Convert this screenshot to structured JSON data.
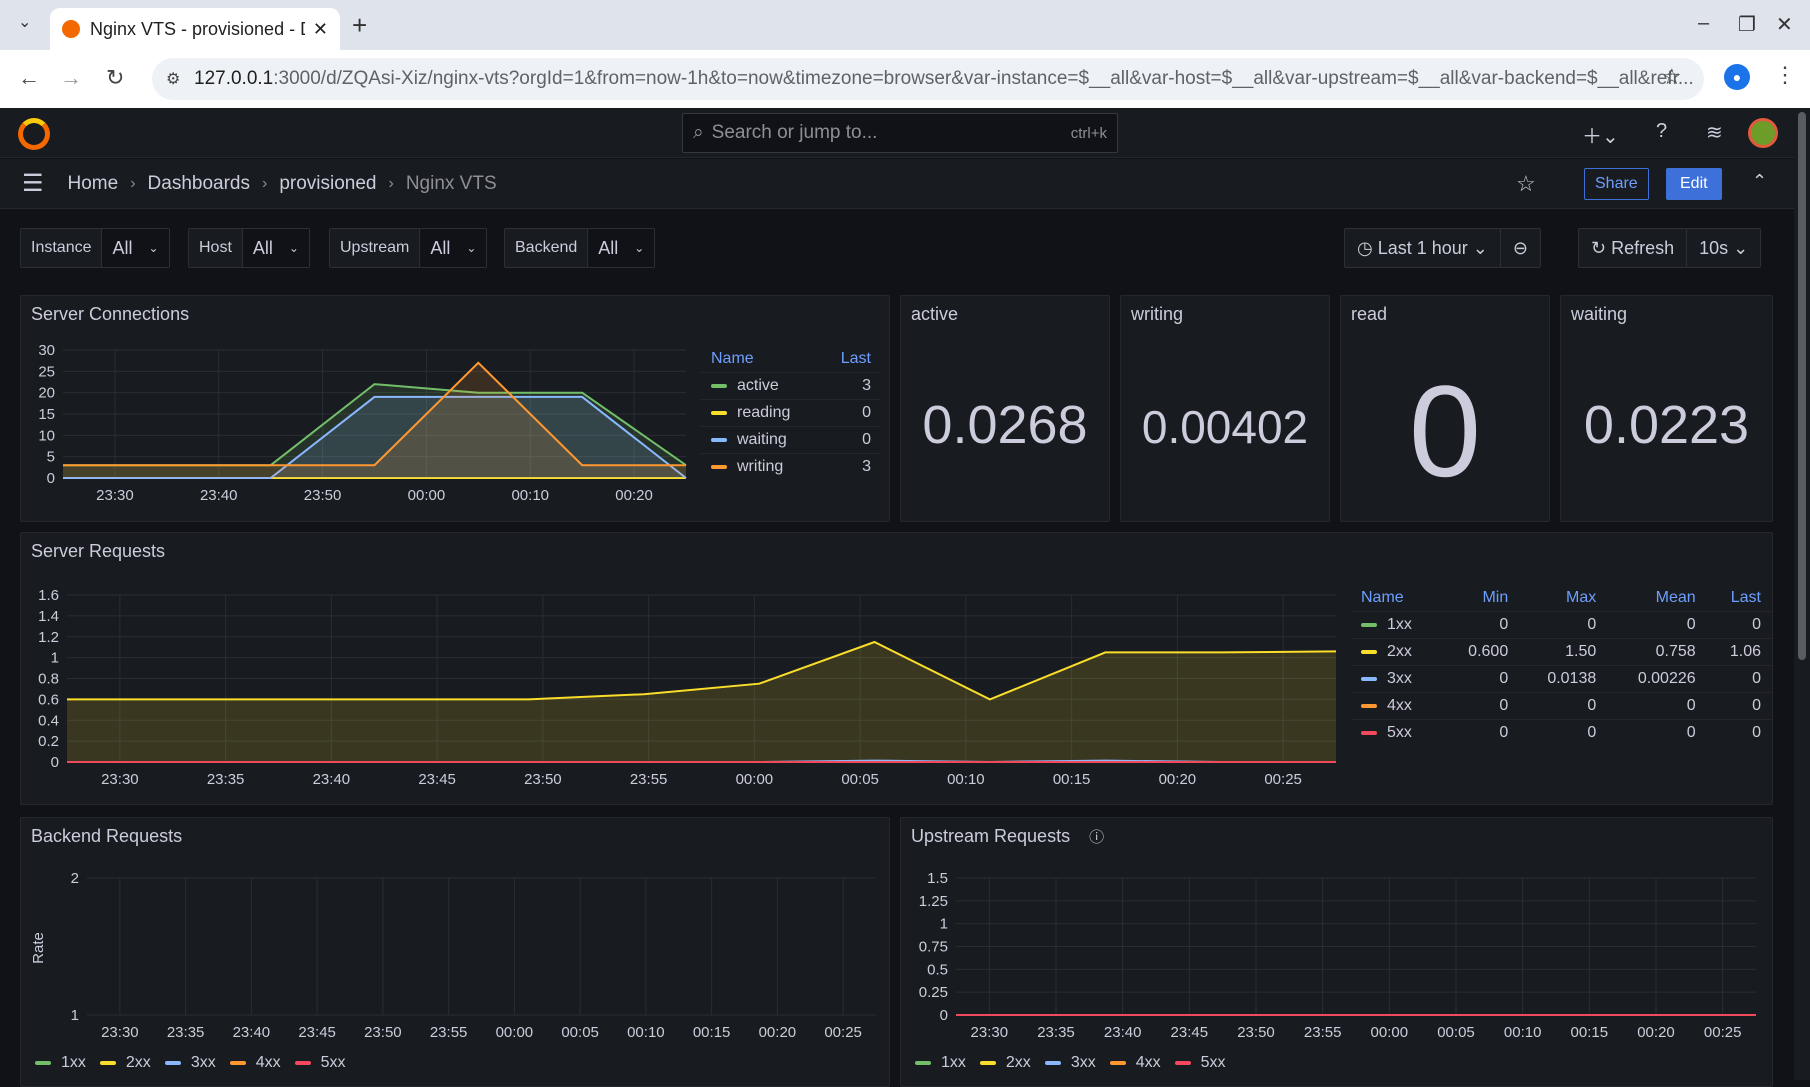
{
  "browser": {
    "tab_title": "Nginx VTS - provisioned - D",
    "url_host": "127.0.0.1",
    "url_rest": ":3000/d/ZQAsi-Xiz/nginx-vts?orgId=1&from=now-1h&to=now&timezone=browser&var-instance=$__all&var-host=$__all&var-upstream=$__all&var-backend=$__all&refr..."
  },
  "topbar": {
    "search_placeholder": "Search or jump to...",
    "search_kbd": "ctrl+k"
  },
  "breadcrumb": [
    "Home",
    "Dashboards",
    "provisioned",
    "Nginx VTS"
  ],
  "actions": {
    "share": "Share",
    "edit": "Edit"
  },
  "variables": [
    {
      "label": "Instance",
      "value": "All"
    },
    {
      "label": "Host",
      "value": "All"
    },
    {
      "label": "Upstream",
      "value": "All"
    },
    {
      "label": "Backend",
      "value": "All"
    }
  ],
  "time": {
    "range": "Last 1 hour",
    "refresh": "Refresh",
    "interval": "10s"
  },
  "stats": [
    {
      "title": "active",
      "value": "0.0268"
    },
    {
      "title": "writing",
      "value": "0.00402"
    },
    {
      "title": "read",
      "value": "0"
    },
    {
      "title": "waiting",
      "value": "0.0223"
    }
  ],
  "colors": {
    "green": "#73bf69",
    "yellow": "#fade2a",
    "blue": "#8ab8ff",
    "orange": "#ff9830",
    "red": "#f2495c"
  },
  "panels": {
    "conn": {
      "title": "Server Connections",
      "legend_headers": [
        "Name",
        "Last"
      ],
      "legend": [
        {
          "name": "active",
          "last": "3",
          "color": "#73bf69"
        },
        {
          "name": "reading",
          "last": "0",
          "color": "#fade2a"
        },
        {
          "name": "waiting",
          "last": "0",
          "color": "#8ab8ff"
        },
        {
          "name": "writing",
          "last": "3",
          "color": "#ff9830"
        }
      ]
    },
    "req": {
      "title": "Server Requests",
      "legend_headers": [
        "Name",
        "Min",
        "Max",
        "Mean",
        "Last"
      ],
      "legend": [
        {
          "name": "1xx",
          "min": "0",
          "max": "0",
          "mean": "0",
          "last": "0",
          "color": "#73bf69"
        },
        {
          "name": "2xx",
          "min": "0.600",
          "max": "1.50",
          "mean": "0.758",
          "last": "1.06",
          "color": "#fade2a"
        },
        {
          "name": "3xx",
          "min": "0",
          "max": "0.0138",
          "mean": "0.00226",
          "last": "0",
          "color": "#8ab8ff"
        },
        {
          "name": "4xx",
          "min": "0",
          "max": "0",
          "mean": "0",
          "last": "0",
          "color": "#ff9830"
        },
        {
          "name": "5xx",
          "min": "0",
          "max": "0",
          "mean": "0",
          "last": "0",
          "color": "#f2495c"
        }
      ]
    },
    "backend": {
      "title": "Backend Requests",
      "ylabel": "Rate"
    },
    "upstream": {
      "title": "Upstream Requests"
    },
    "bottom_legend": [
      {
        "name": "1xx",
        "color": "#73bf69"
      },
      {
        "name": "2xx",
        "color": "#fade2a"
      },
      {
        "name": "3xx",
        "color": "#8ab8ff"
      },
      {
        "name": "4xx",
        "color": "#ff9830"
      },
      {
        "name": "5xx",
        "color": "#f2495c"
      }
    ]
  },
  "chart_data": [
    {
      "type": "line",
      "title": "Server Connections",
      "x": [
        "23:30",
        "23:40",
        "23:50",
        "00:00",
        "00:10",
        "00:20"
      ],
      "ylim": [
        0,
        30
      ],
      "yticks": [
        0,
        5,
        10,
        15,
        20,
        25,
        30
      ],
      "series": [
        {
          "name": "active",
          "values": [
            3,
            3,
            3,
            22,
            20,
            20,
            3
          ]
        },
        {
          "name": "reading",
          "values": [
            0,
            0,
            0,
            0,
            0,
            0,
            0
          ]
        },
        {
          "name": "waiting",
          "values": [
            0,
            0,
            0,
            19,
            19,
            19,
            0
          ]
        },
        {
          "name": "writing",
          "values": [
            3,
            3,
            3,
            3,
            27,
            3,
            3
          ]
        }
      ]
    },
    {
      "type": "area",
      "title": "Server Requests",
      "x": [
        "23:30",
        "23:35",
        "23:40",
        "23:45",
        "23:50",
        "23:55",
        "00:00",
        "00:05",
        "00:10",
        "00:15",
        "00:20",
        "00:25"
      ],
      "ylim": [
        0,
        1.6
      ],
      "yticks": [
        0,
        0.2,
        0.4,
        0.6,
        0.8,
        1,
        1.2,
        1.4,
        1.6
      ],
      "series": [
        {
          "name": "2xx",
          "values": [
            0.6,
            0.6,
            0.6,
            0.6,
            0.6,
            0.65,
            0.75,
            1.15,
            0.6,
            1.05,
            1.05,
            1.06
          ]
        },
        {
          "name": "3xx",
          "values": [
            0,
            0,
            0,
            0,
            0,
            0,
            0,
            0.0138,
            0,
            0.0138,
            0,
            0
          ]
        }
      ]
    },
    {
      "type": "bar",
      "title": "Backend Requests",
      "x": [
        "23:30",
        "23:35",
        "23:40",
        "23:45",
        "23:50",
        "23:55",
        "00:00",
        "00:05",
        "00:10",
        "00:15",
        "00:20",
        "00:25"
      ],
      "ylabel": "Rate",
      "ylim": [
        1,
        2
      ],
      "yticks": [
        1,
        2
      ]
    },
    {
      "type": "line",
      "title": "Upstream Requests",
      "x": [
        "23:30",
        "23:35",
        "23:40",
        "23:45",
        "23:50",
        "23:55",
        "00:00",
        "00:05",
        "00:10",
        "00:15",
        "00:20",
        "00:25"
      ],
      "ylim": [
        0,
        1.5
      ],
      "yticks": [
        0,
        0.25,
        0.5,
        0.75,
        1,
        1.25,
        1.5
      ]
    }
  ]
}
